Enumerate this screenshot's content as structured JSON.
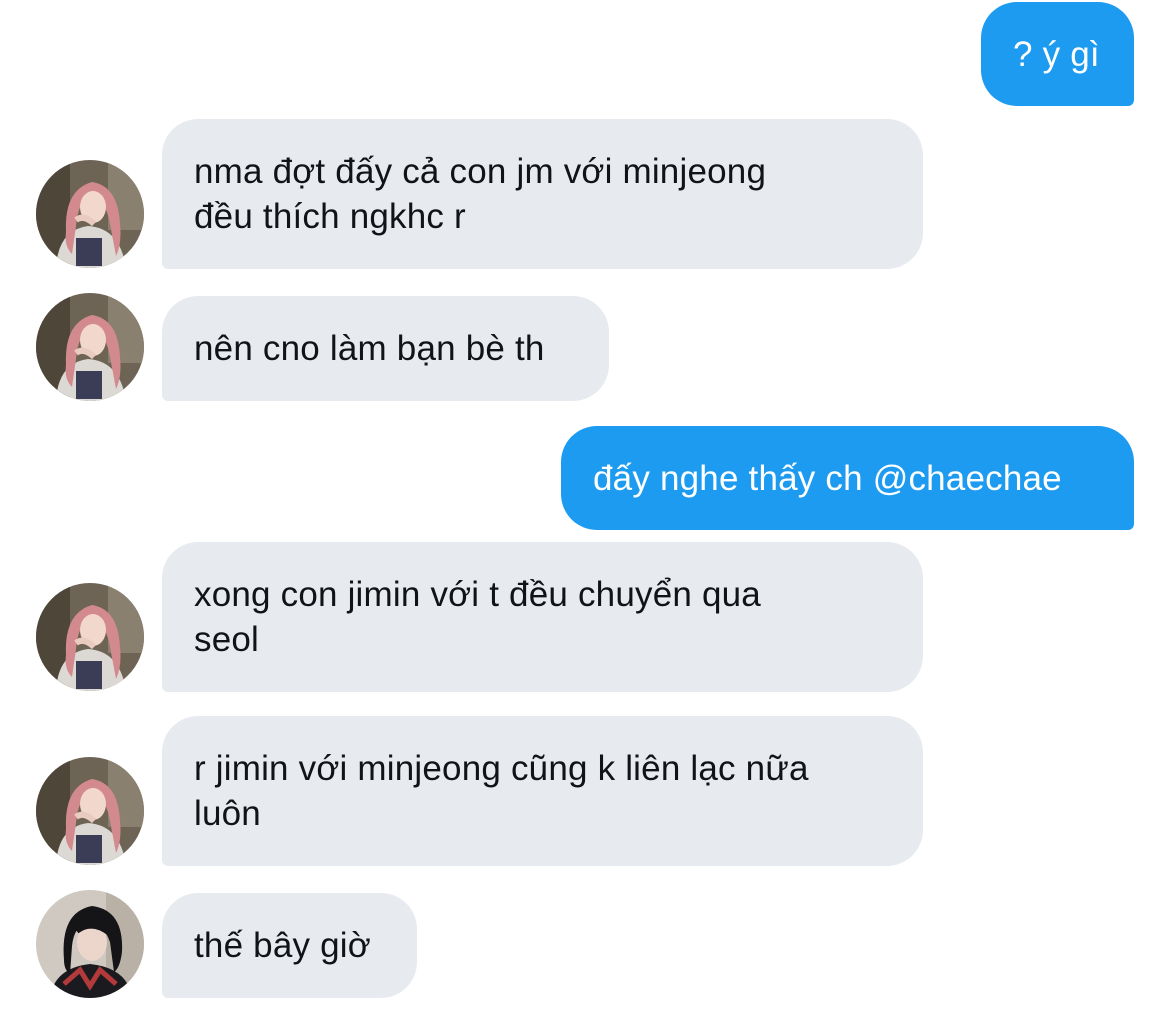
{
  "conversation": {
    "messages": [
      {
        "direction": "outgoing",
        "text": "? ý gì"
      },
      {
        "direction": "incoming",
        "text": "nma đợt đấy cả con jm với minjeong đều thích ngkhc r",
        "line1": "nma đợt đấy cả con jm với minjeong",
        "line2": "đều thích ngkhc r",
        "avatar": "pink-hair-avatar"
      },
      {
        "direction": "incoming",
        "text": "nên cno làm bạn bè th",
        "avatar": "pink-hair-avatar"
      },
      {
        "direction": "outgoing",
        "text": "đấy nghe thấy ch @chaechae"
      },
      {
        "direction": "incoming",
        "text": "xong con jimin với t đều chuyển qua seol",
        "line1": "xong con jimin với t đều chuyển qua",
        "line2": "seol",
        "avatar": "pink-hair-avatar"
      },
      {
        "direction": "incoming",
        "text": "r jimin với minjeong cũng k liên lạc nữa luôn",
        "line1": "r jimin với minjeong cũng k liên lạc nữa",
        "line2": "luôn",
        "avatar": "pink-hair-avatar"
      },
      {
        "direction": "incoming",
        "text": "thế bây giờ",
        "avatar": "dark-hair-avatar"
      }
    ]
  },
  "colors": {
    "outgoing_bubble": "#1d9bf0",
    "incoming_bubble": "#e7ebef",
    "outgoing_text": "#ffffff",
    "incoming_text": "#111417"
  }
}
